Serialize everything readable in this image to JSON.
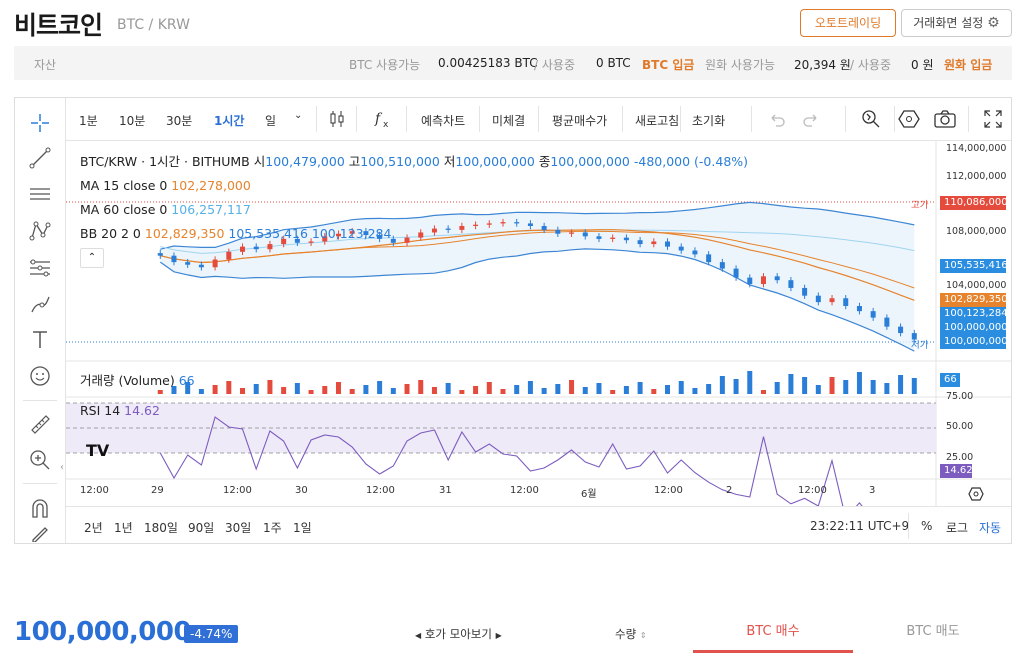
{
  "header": {
    "title": "비트코인",
    "pair": "BTC / KRW",
    "auto_trade": "오토트레이딩",
    "screen_settings": "거래화면 설정"
  },
  "assets": {
    "label": "자산",
    "btc_avail_label": "BTC 사용가능",
    "btc_avail_value": "0.00425183 BTC",
    "btc_inuse": "/ 사용중",
    "btc_inuse_value": "0 BTC",
    "btc_deposit": "BTC 입금",
    "krw_avail_label": "원화 사용가능",
    "krw_avail_value": "20,394 원",
    "krw_inuse": "/ 사용중",
    "krw_inuse_value": "0 원",
    "krw_deposit": "원화 입금"
  },
  "toolbar": {
    "intervals": [
      "1분",
      "10분",
      "30분",
      "1시간",
      "일"
    ],
    "active_interval": "1시간",
    "forecast": "예측차트",
    "unfilled": "미체결",
    "avg_price": "평균매수가",
    "refresh": "새로고침",
    "reset": "초기화"
  },
  "legend": {
    "symbol": "BTC/KRW · 1시간 · BITHUMB",
    "open_label": "시",
    "open": "100,479,000",
    "high_label": "고",
    "high": "100,510,000",
    "low_label": "저",
    "low": "100,000,000",
    "close_label": "종",
    "close": "100,000,000",
    "change": "-480,000 (-0.48%)",
    "ma15_label": "MA 15 close 0",
    "ma15": "102,278,000",
    "ma60_label": "MA 60 close 0",
    "ma60": "106,257,117",
    "bb_label": "BB 20 2 0",
    "bb_mid": "102,829,350",
    "bb_upper": "105,535,416",
    "bb_lower": "100,123,284",
    "volume_label": "거래량 (Volume)",
    "volume": "66",
    "rsi_label": "RSI 14",
    "rsi": "14.62"
  },
  "price_axis": {
    "ticks": [
      "114,000,000",
      "112,000,000",
      "110,000,000",
      "108,000,000",
      "106,000,000",
      "104,000,000",
      "102,000,000",
      "100,000,000"
    ],
    "high_marker_label": "고가",
    "high_marker": "110,086,000",
    "low_marker_label": "저가",
    "low_marker": "100,000,000",
    "bb_upper_pill": "105,535,416",
    "bb_mid_pill": "102,829,350",
    "bb_lower_pill": "100,123,284",
    "close_pill": "100,000,000",
    "volume_pill": "66",
    "rsi_ticks": [
      "75.00",
      "50.00",
      "25.00"
    ],
    "rsi_pill": "14.62"
  },
  "time_axis": [
    "12:00",
    "29",
    "12:00",
    "30",
    "12:00",
    "31",
    "12:00",
    "6월",
    "12:00",
    "2",
    "12:00",
    "3"
  ],
  "bottom_bar": {
    "ranges": [
      "2년",
      "1년",
      "180일",
      "90일",
      "30일",
      "1주",
      "1일"
    ],
    "clock": "23:22:11 UTC+9",
    "percent": "%",
    "log": "로그",
    "auto": "자동"
  },
  "ticker": {
    "price": "100,000,000",
    "change_pct": "-4.74%",
    "orderbook_view": "호가 모아보기",
    "quantity": "수량",
    "buy_tab": "BTC 매수",
    "sell_tab": "BTC 매도"
  },
  "chart_data": {
    "type": "candlestick",
    "title": "BTC/KRW · 1시간 · BITHUMB",
    "x_labels": [
      "12:00",
      "29",
      "12:00",
      "30",
      "12:00",
      "31",
      "12:00",
      "6월",
      "12:00",
      "2",
      "12:00",
      "3"
    ],
    "ylim": [
      99500000,
      115000000
    ],
    "close_approx": [
      106500000,
      106000000,
      105800000,
      105600000,
      106200000,
      106800000,
      107200000,
      107000000,
      107400000,
      107800000,
      107500000,
      107600000,
      108000000,
      108200000,
      108400000,
      108100000,
      107800000,
      107500000,
      107900000,
      108300000,
      108600000,
      108500000,
      108800000,
      108900000,
      109000000,
      109100000,
      109000000,
      108800000,
      108500000,
      108200000,
      108300000,
      108000000,
      107800000,
      107900000,
      107700000,
      107400000,
      107600000,
      107200000,
      106900000,
      106600000,
      106000000,
      105500000,
      104800000,
      104300000,
      104900000,
      104600000,
      104000000,
      103400000,
      102900000,
      103200000,
      102600000,
      102200000,
      101700000,
      101000000,
      100500000,
      100000000
    ],
    "series": [
      {
        "name": "MA 15 close 0",
        "last": 102278000
      },
      {
        "name": "MA 60 close 0",
        "last": 106257117
      },
      {
        "name": "BB 20 2 0",
        "mid": 102829350,
        "upper": 105535416,
        "lower": 100123284
      }
    ],
    "volume_last": 66,
    "rsi_last": 14.62,
    "rsi_levels": [
      75,
      50,
      25
    ],
    "colors": {
      "up": "#e54b3c",
      "down": "#2a7ed8",
      "ma15": "#e6832c",
      "ma60": "#9fd4f0",
      "bb": "#3d86d4"
    }
  }
}
